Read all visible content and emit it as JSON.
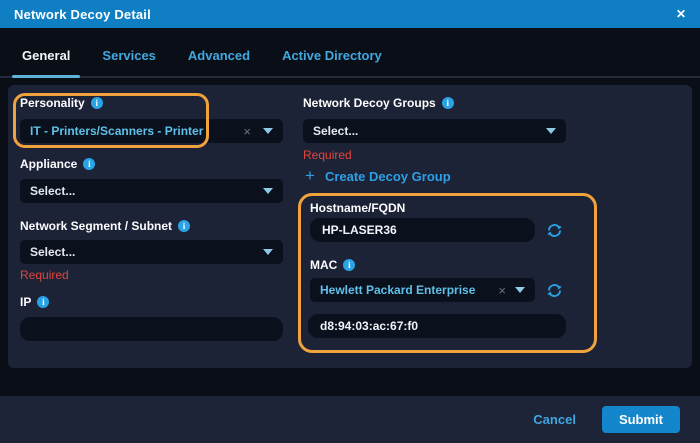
{
  "modal": {
    "title": "Network Decoy Detail"
  },
  "icons": {
    "close": "✕",
    "info": "i",
    "clear": "×",
    "plus": "+"
  },
  "tabs": [
    {
      "label": "General",
      "active": true
    },
    {
      "label": "Services",
      "active": false
    },
    {
      "label": "Advanced",
      "active": false
    },
    {
      "label": "Active Directory",
      "active": false
    }
  ],
  "form": {
    "personality": {
      "label": "Personality",
      "value": "IT - Printers/Scanners - Printer"
    },
    "appliance": {
      "label": "Appliance",
      "placeholder": "Select..."
    },
    "network_segment": {
      "label": "Network Segment / Subnet",
      "placeholder": "Select...",
      "error": "Required"
    },
    "ip": {
      "label": "IP",
      "value": ""
    },
    "decoy_groups": {
      "label": "Network Decoy Groups",
      "placeholder": "Select...",
      "error": "Required"
    },
    "create_decoy_group_label": "Create Decoy Group",
    "hostname": {
      "label": "Hostname/FQDN",
      "value": "HP-LASER36"
    },
    "mac": {
      "label": "MAC",
      "vendor_value": "Hewlett Packard Enterprise",
      "address_value": "d8:94:03:ac:67:f0"
    }
  },
  "footer": {
    "cancel_label": "Cancel",
    "submit_label": "Submit"
  },
  "colors": {
    "header_bar": "#0f7ec3",
    "panel_bg": "#1d2336",
    "field_bg": "#0b101d",
    "accent_blue": "#2e9fe6",
    "selected_value_text": "#5fc1e8",
    "annotation_orange": "#f0a23c",
    "error_red": "#e0453e",
    "submit_bg": "#1486cb"
  }
}
